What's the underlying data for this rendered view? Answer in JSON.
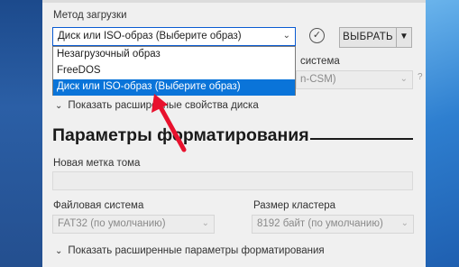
{
  "boot": {
    "label": "Метод загрузки",
    "selected": "Диск или ISO-образ (Выберите образ)",
    "options": [
      "Незагрузочный образ",
      "FreeDOS",
      "Диск или ISO-образ (Выберите образ)"
    ],
    "selected_index": 2,
    "select_button": "ВЫБРАТЬ"
  },
  "target": {
    "label_partial": "система",
    "value_partial": "n-CSM)",
    "help": "?"
  },
  "disk_toggle": "Показать расширенные свойства диска",
  "format": {
    "title": "Параметры форматирования",
    "volume_label": "Новая метка тома",
    "volume_value": "",
    "filesystem_label": "Файловая система",
    "filesystem_value": "FAT32 (по умолчанию)",
    "cluster_label": "Размер кластера",
    "cluster_value": "8192 байт (по умолчанию)",
    "advanced_toggle": "Показать расширенные параметры форматирования"
  },
  "icons": {
    "check": "check-circle-icon",
    "dropdown": "chevron-down-icon",
    "annotation": "red-arrow"
  },
  "colors": {
    "highlight": "#0a74d9",
    "annotation": "#e8112d",
    "window_bg": "#f0f0f0"
  }
}
